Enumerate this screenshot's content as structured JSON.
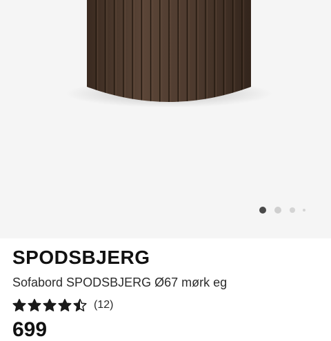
{
  "product": {
    "image_alt": "Sofabord SPODSBJERG Ø67 mørk eg",
    "carousel": {
      "total_dots": 4,
      "active_index": 0
    },
    "brand": "SPODSBJERG",
    "subtitle": "Sofabord SPODSBJERG Ø67 mørk eg",
    "rating": {
      "value": 4.5,
      "max": 5,
      "review_count_label": "(12)"
    },
    "price": "699"
  },
  "colors": {
    "image_background": "#f5f5f5",
    "wood_dark": "#3f2f25",
    "wood_light": "#5a4537",
    "star": "#1a1a1a",
    "dot_active": "#4a4a4a",
    "dot_inactive": "#cfcfcf"
  }
}
